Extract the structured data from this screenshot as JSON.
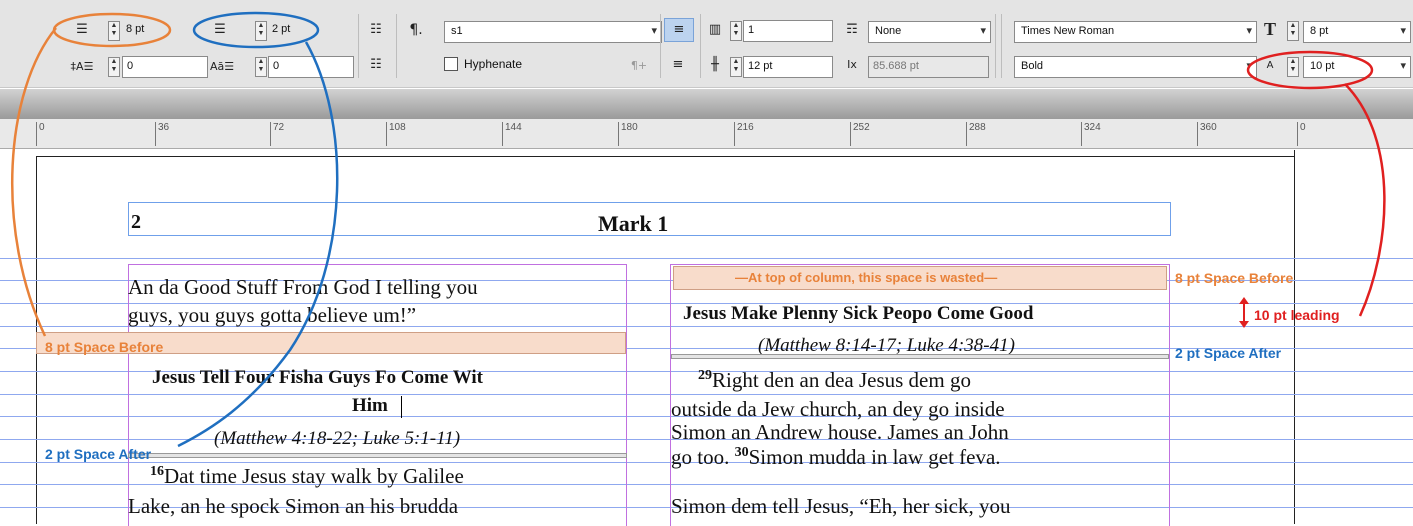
{
  "control_panel": {
    "space_before_value": "8 pt",
    "first_line_indent_value": "0",
    "space_after_value": "2 pt",
    "drop_cap_lines_value": "0",
    "paragraph_style": "s1",
    "hyphenate_label": "Hyphenate",
    "columns_value": "1",
    "gutter_value": "12 pt",
    "width_value": "85.688 pt",
    "span_value": "None",
    "font_family": "Times New Roman",
    "font_style": "Bold",
    "font_size": "8 pt",
    "leading": "10 pt"
  },
  "ruler": {
    "ticks": [
      "0",
      "36",
      "72",
      "108",
      "144",
      "180",
      "216",
      "252",
      "288",
      "324",
      "360",
      "0"
    ]
  },
  "document": {
    "header_page_number": "2",
    "header_title": "Mark 1",
    "left_column": {
      "lines": [
        "An da Good Stuff From God I telling you",
        "guys, you guys gotta believe um!”"
      ],
      "heading_line1": "Jesus Tell Four Fisha Guys Fo Come Wit",
      "heading_line2": "Him",
      "reference": "(Matthew 4:18-22; Luke 5:1-11)",
      "verse_number": "16",
      "verse_line1": "Dat time Jesus stay walk by Galilee",
      "verse_line2": "Lake, an he spock Simon an his brudda"
    },
    "right_column": {
      "wasted_label": "—At top of column, this space is wasted—",
      "heading": "Jesus Make Plenny Sick Peopo Come Good",
      "reference": "(Matthew 8:14-17; Luke 4:38-41)",
      "verse_number_1": "29",
      "line1": "Right den an dea Jesus dem go",
      "line2": "outside da Jew church, an dey go inside",
      "line3": "Simon an Andrew house. James an John",
      "line4_prefix": "go too. ",
      "verse_number_2": "30",
      "line4_rest": "Simon mudda in law get feva.",
      "line5": "Simon dem tell Jesus, “Eh, her sick, you"
    }
  },
  "annotations": {
    "space_before_left": "8 pt Space Before",
    "space_after_left": "2 pt Space After",
    "space_before_right": "8 pt Space Before",
    "leading_right": "10 pt leading",
    "space_after_right": "2 pt Space After"
  },
  "colors": {
    "orange": "#e8823a",
    "blue": "#1f6fc0",
    "red": "#e02020",
    "frame_purple": "#c070e0",
    "frame_blue": "#6fa0ea",
    "highlight": "#f8dccb",
    "baseline": "#8fa8ef"
  }
}
